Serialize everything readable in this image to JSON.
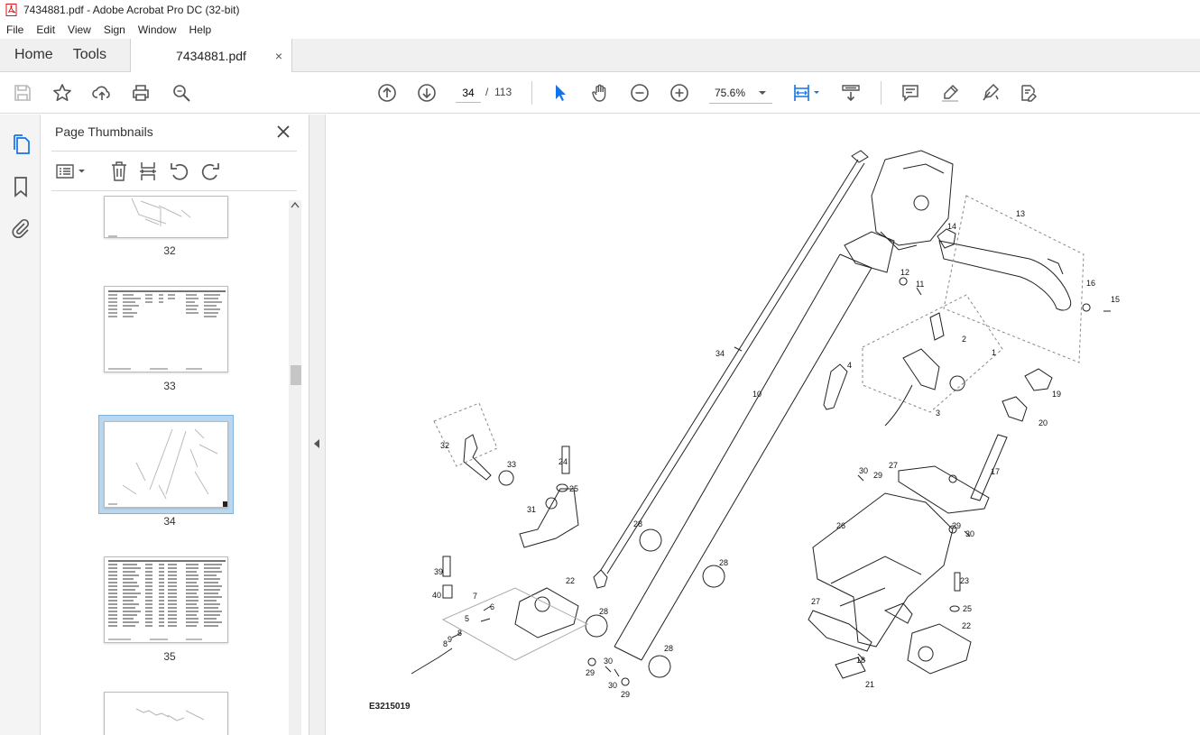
{
  "window": {
    "title": "7434881.pdf - Adobe Acrobat Pro DC (32-bit)"
  },
  "menu": [
    "File",
    "Edit",
    "View",
    "Sign",
    "Window",
    "Help"
  ],
  "tabs": {
    "home": "Home",
    "tools": "Tools",
    "document": "7434881.pdf",
    "close": "×"
  },
  "toolbar": {
    "current_page": "34",
    "page_separator": "/",
    "total_pages": "113",
    "zoom": "75.6%"
  },
  "panel": {
    "title": "Page Thumbnails",
    "thumbnails": [
      {
        "label": "32"
      },
      {
        "label": "33"
      },
      {
        "label": "34",
        "selected": true
      },
      {
        "label": "35"
      },
      {
        "label": ""
      }
    ]
  },
  "document": {
    "figure_code": "E3215019",
    "part_labels": [
      "1",
      "2",
      "3",
      "4",
      "5",
      "6",
      "7",
      "8",
      "8",
      "9",
      "10",
      "11",
      "12",
      "13",
      "14",
      "15",
      "16",
      "17",
      "18",
      "19",
      "20",
      "21",
      "22",
      "22",
      "23",
      "24",
      "25",
      "25",
      "26",
      "27",
      "27",
      "28",
      "28",
      "28",
      "28",
      "29",
      "29",
      "29",
      "29",
      "30",
      "30",
      "30",
      "30",
      "31",
      "32",
      "33",
      "34",
      "39",
      "40"
    ]
  },
  "colors": {
    "accent": "#1473e6",
    "selected_thumb": "#b9d7ee"
  }
}
